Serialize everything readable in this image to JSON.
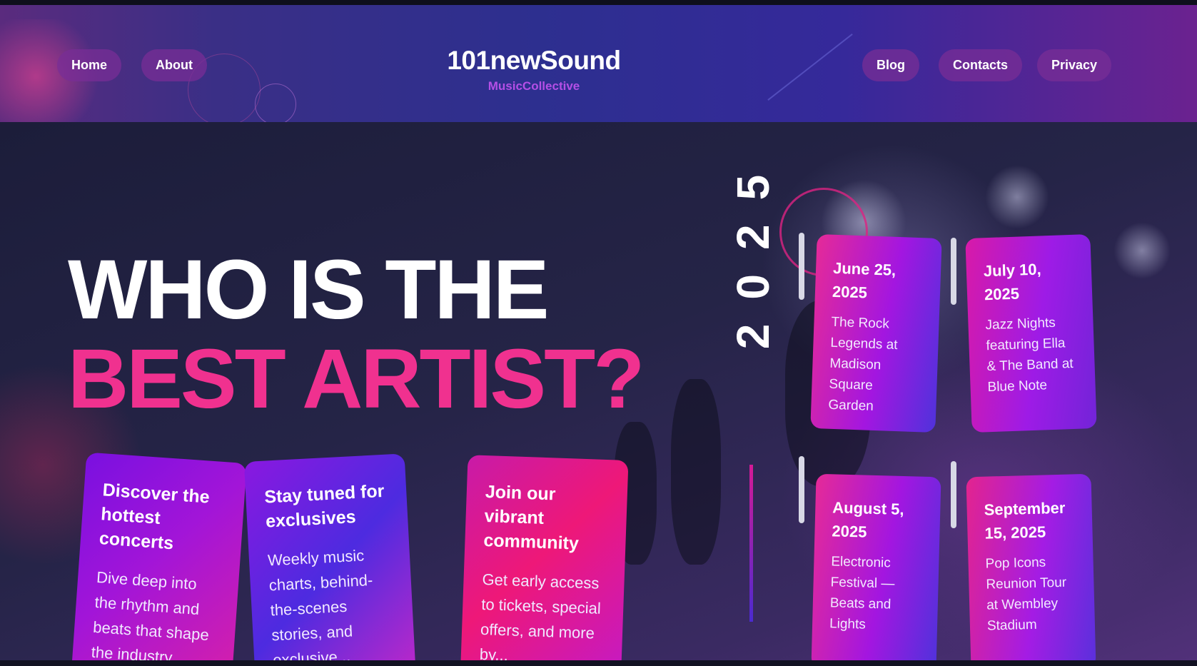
{
  "nav": {
    "left": [
      {
        "label": "Home"
      },
      {
        "label": "About"
      }
    ],
    "right": [
      {
        "label": "Blog"
      },
      {
        "label": "Contacts"
      },
      {
        "label": "Privacy"
      }
    ]
  },
  "brand": {
    "name": "101newSound",
    "tagline": "MusicCollective"
  },
  "hero": {
    "title_line1": "WHO IS THE",
    "title_line2": "BEST ARTIST?"
  },
  "features": [
    {
      "title": "Discover the hottest concerts",
      "text": "Dive deep into the rhythm and beats that shape the industry..."
    },
    {
      "title": "Stay tuned for exclusives",
      "text": "Weekly music charts, behind-the-scenes stories, and exclusive..."
    },
    {
      "title": "Join our vibrant community",
      "text": "Get early access to tickets, special offers, and more by..."
    }
  ],
  "timeline": {
    "year": "2025",
    "events": [
      {
        "date": "June 25, 2025",
        "title": "The Rock Legends at Madison Square Garden"
      },
      {
        "date": "July 10, 2025",
        "title": "Jazz Nights featuring Ella & The Band at Blue Note"
      },
      {
        "date": "August 5, 2025",
        "title": "Electronic Festival — Beats and Lights"
      },
      {
        "date": "September 15, 2025",
        "title": "Pop Icons Reunion Tour at Wembley Stadium"
      }
    ]
  },
  "colors": {
    "accent_pink": "#f0318f",
    "accent_purple": "#b44fe6",
    "background": "#1c1d3a"
  }
}
